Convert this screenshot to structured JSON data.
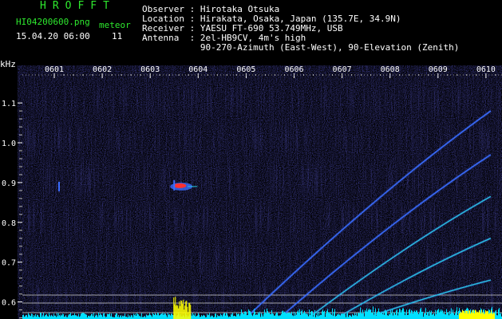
{
  "header": {
    "logo": "HROFFT",
    "filename": "HI04200600.png",
    "datetime": "15.04.20 06:00",
    "meteor_label": "meteor",
    "meteor_count": "11",
    "observer": "Observer : Hirotaka Otsuka",
    "location": "Location : Hirakata, Osaka, Japan (135.7E, 34.9N)",
    "receiver": "Receiver : YAESU FT-690 53.749MHz, USB",
    "antenna": "Antenna  : 2el-HB9CV, 4m's high",
    "antenna2": "           90-270-Azimuth (East-West), 90-Elevation (Zenith)"
  },
  "colors": {
    "background": "#000000",
    "noise": "#1a1a8c",
    "trace": "#3a6cff",
    "trace_bright": "#28c8e0",
    "meteor_core": "#ff3030",
    "power_yellow": "#ffff00",
    "power_cyan": "#00e0ff",
    "grid_line": "#c8c8c8"
  },
  "chart_data": {
    "type": "heatmap",
    "ylabel": "kHz",
    "x_ticks": [
      "0601",
      "0602",
      "0603",
      "0604",
      "0605",
      "0606",
      "0607",
      "0608",
      "0609",
      "0610"
    ],
    "y_ticks": [
      "1.1",
      "1.0",
      "0.9",
      "0.8",
      "0.7",
      "0.6"
    ],
    "ylim": [
      0.56,
      1.14
    ],
    "xlim_minutes": [
      0.4,
      10.1
    ],
    "meteor_echoes": [
      {
        "minute": 3.55,
        "khz": 0.89,
        "strength": "strong"
      },
      {
        "minute": 1.1,
        "khz": 0.89,
        "strength": "weak"
      }
    ],
    "drift_traces": [
      {
        "name": "",
        "start_minute": 5.0,
        "end_minute": 10.1,
        "start_khz": 0.56,
        "end_khz": 1.08
      },
      {
        "name": "",
        "start_minute": 5.7,
        "end_minute": 10.1,
        "start_khz": 0.56,
        "end_khz": 0.97
      },
      {
        "name": "",
        "start_minute": 6.3,
        "end_minute": 10.1,
        "start_khz": 0.56,
        "end_khz": 0.865
      },
      {
        "name": "",
        "start_minute": 6.9,
        "end_minute": 10.1,
        "start_khz": 0.56,
        "end_khz": 0.76
      },
      {
        "name": "",
        "start_minute": 7.5,
        "end_minute": 10.1,
        "start_khz": 0.56,
        "end_khz": 0.655
      }
    ]
  }
}
